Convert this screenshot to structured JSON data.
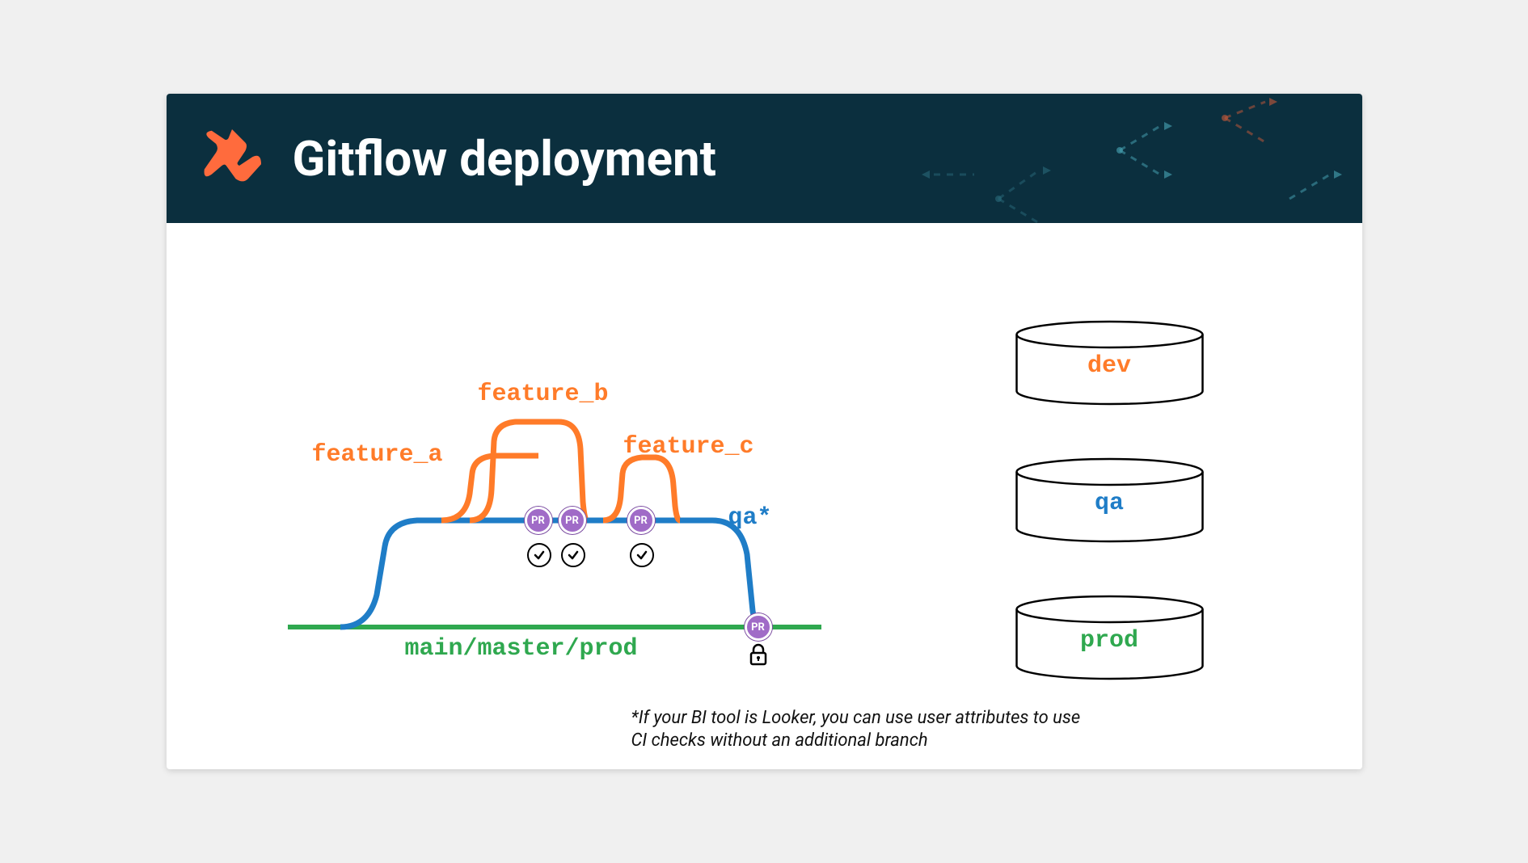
{
  "header": {
    "title": "Gitflow deployment"
  },
  "diagram": {
    "branches": {
      "feature_a": "feature_a",
      "feature_b": "feature_b",
      "feature_c": "feature_c",
      "qa": "qa*",
      "main": "main/master/prod"
    },
    "pr_label": "PR"
  },
  "databases": {
    "dev": "dev",
    "qa": "qa",
    "prod": "prod"
  },
  "footnote": "*If your BI tool is Looker, you can use user attributes to use CI checks without an additional branch",
  "colors": {
    "orange": "#ff7b29",
    "blue": "#1f7dc7",
    "green": "#2fa84f",
    "purple": "#a06bc7",
    "header_bg": "#0b2f3e"
  }
}
